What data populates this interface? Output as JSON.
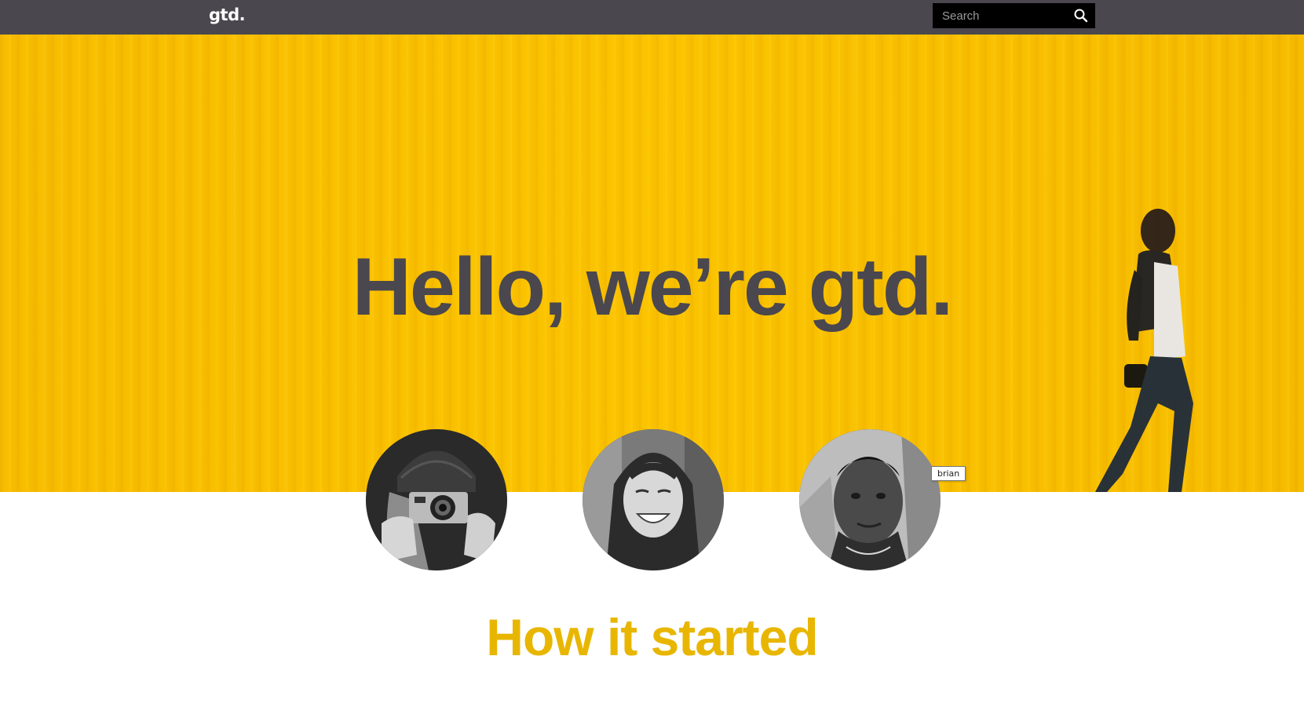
{
  "header": {
    "logo": "gtd.",
    "search": {
      "placeholder": "Search",
      "value": ""
    }
  },
  "hero": {
    "title": "Hello, we’re gtd."
  },
  "team": {
    "tooltip": "brian"
  },
  "section": {
    "title": "How it started"
  },
  "colors": {
    "topbar": "#4a474e",
    "hero_yellow": "#f7c200",
    "hero_title": "#4a474e",
    "section_title": "#e8b600"
  }
}
